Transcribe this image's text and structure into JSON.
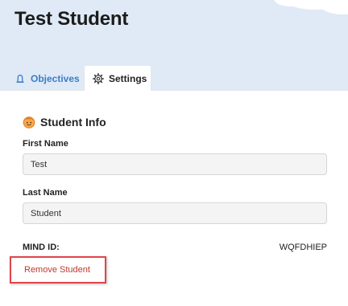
{
  "header": {
    "title": "Test Student"
  },
  "tabs": [
    {
      "label": "Objectives",
      "icon": "bell-icon",
      "active": false
    },
    {
      "label": "Settings",
      "icon": "gear-icon",
      "active": true
    }
  ],
  "student_info": {
    "title": "Student Info",
    "icon": "student-face-icon",
    "first_name_label": "First Name",
    "first_name_value": "Test",
    "last_name_label": "Last Name",
    "last_name_value": "Student",
    "mind_id_label": "MIND ID:",
    "mind_id_value": "WQFDHIEP",
    "remove_label": "Remove Student"
  },
  "colors": {
    "header_bg": "#dfeaf6",
    "link_blue": "#3b7bc8",
    "remove_red": "#c0392b",
    "highlight_red": "#e0454a",
    "icon_orange": "#f08a24"
  }
}
